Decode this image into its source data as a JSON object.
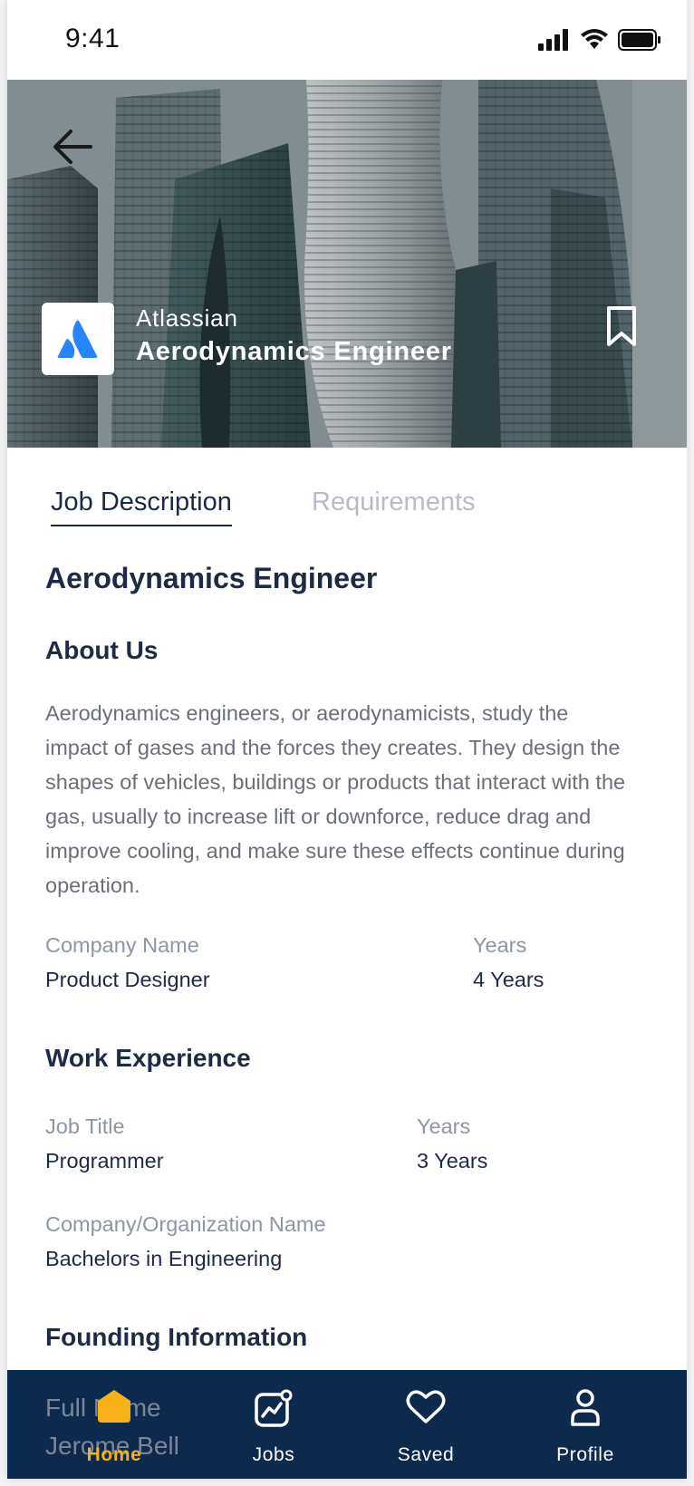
{
  "status_bar": {
    "time": "9:41"
  },
  "hero": {
    "company": "Atlassian",
    "job_title": "Aerodynamics Engineer"
  },
  "tabs": [
    {
      "label": "Job Description",
      "active": true
    },
    {
      "label": "Requirements",
      "active": false
    }
  ],
  "content": {
    "title": "Aerodynamics Engineer",
    "about_heading": "About Us",
    "about_lines": [
      "Aerodynamics engineers, or aerodynamicists, study the",
      "impact of gases and the forces they creates. They design the",
      "shapes of vehicles, buildings or products that interact with the",
      "gas, usually to increase lift or downforce, reduce drag and",
      "improve cooling, and make sure these effects continue during",
      "operation."
    ],
    "company_name_label": "Company Name",
    "company_name_value": "Product Designer",
    "years_label": "Years",
    "years_value": "4 Years",
    "work_heading": "Work Experience",
    "job_title_label": "Job Title",
    "job_title_value": "Programmer",
    "work_years_label": "Years",
    "work_years_value": "3 Years",
    "org_label": "Company/Organization Name",
    "org_value": "Bachelors in Engineering",
    "founding_heading": "Founding Information",
    "full_name_label": "Full Name",
    "full_name_value": "Jerome Bell"
  },
  "bottom_nav": [
    {
      "label": "Home",
      "icon": "home-icon",
      "active": true
    },
    {
      "label": "Jobs",
      "icon": "jobs-chart-icon",
      "active": false
    },
    {
      "label": "Saved",
      "icon": "heart-icon",
      "active": false
    },
    {
      "label": "Profile",
      "icon": "user-icon",
      "active": false
    }
  ],
  "colors": {
    "nav_bg": "#0b2a4d",
    "accent": "#f7b21b",
    "heading": "#1f2a44",
    "muted": "#8f96a3",
    "brand_logo": "#2684ff"
  }
}
